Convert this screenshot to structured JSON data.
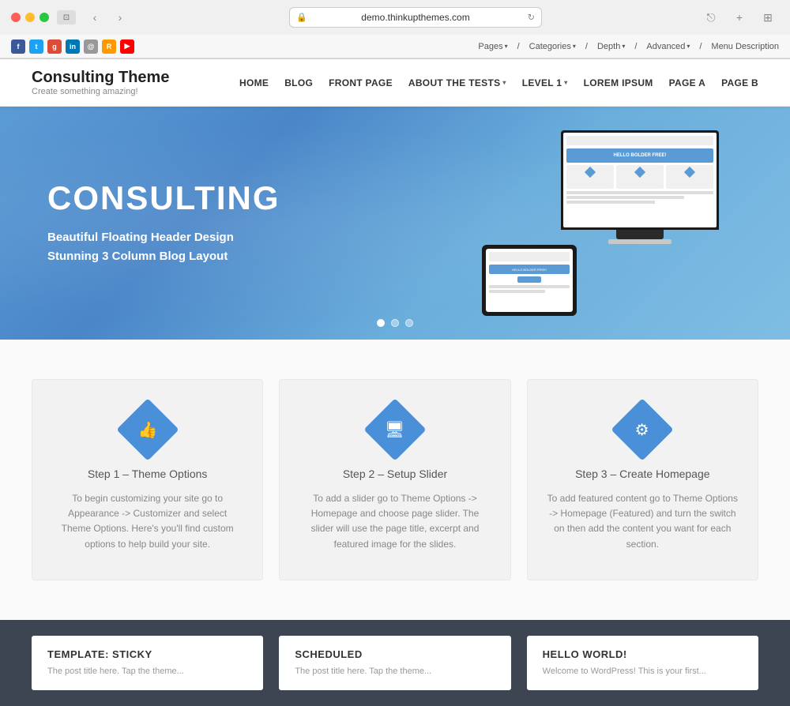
{
  "browser": {
    "url": "demo.thinkupthemes.com",
    "refresh_icon": "↻",
    "security_icon": "🔒",
    "back_icon": "‹",
    "forward_icon": "›",
    "share_icon": "⎋",
    "new_tab_icon": "+",
    "grid_icon": "⊞",
    "window_icon": "⊡"
  },
  "toolbar2": {
    "social": [
      {
        "name": "Facebook",
        "label": "f",
        "class": "si-fb"
      },
      {
        "name": "Twitter",
        "label": "t",
        "class": "si-tw"
      },
      {
        "name": "Google+",
        "label": "g+",
        "class": "si-gp"
      },
      {
        "name": "LinkedIn",
        "label": "in",
        "class": "si-li"
      },
      {
        "name": "Email",
        "label": "@",
        "class": "si-em"
      },
      {
        "name": "RSS",
        "label": "R",
        "class": "si-rss"
      },
      {
        "name": "YouTube",
        "label": "▶",
        "class": "si-yt"
      }
    ],
    "menu_items": [
      {
        "label": "Pages"
      },
      {
        "label": "Categories"
      },
      {
        "label": "Depth"
      },
      {
        "label": "Advanced"
      },
      {
        "label": "Menu Description",
        "no_arrow": true
      }
    ]
  },
  "site": {
    "logo": {
      "title": "Consulting Theme",
      "tagline": "Create something amazing!"
    },
    "nav": [
      {
        "label": "HOME",
        "has_dropdown": false
      },
      {
        "label": "BLOG",
        "has_dropdown": false
      },
      {
        "label": "FRONT PAGE",
        "has_dropdown": false
      },
      {
        "label": "ABOUT THE TESTS",
        "has_dropdown": true
      },
      {
        "label": "LEVEL 1",
        "has_dropdown": true
      },
      {
        "label": "LOREM IPSUM",
        "has_dropdown": false
      },
      {
        "label": "PAGE A",
        "has_dropdown": false
      },
      {
        "label": "PAGE B",
        "has_dropdown": false
      }
    ],
    "hero": {
      "title": "CONSULTING",
      "subtitle_line1": "Beautiful Floating Header Design",
      "subtitle_line2": "Stunning 3 Column Blog Layout",
      "dots": [
        {
          "active": true
        },
        {
          "active": false
        },
        {
          "active": false
        }
      ]
    },
    "steps": [
      {
        "icon": "👍",
        "title": "Step 1 – Theme Options",
        "description": "To begin customizing your site go to Appearance -> Customizer and select Theme Options. Here's you'll find custom options to help build your site."
      },
      {
        "icon": "🖥",
        "title": "Step 2 – Setup Slider",
        "description": "To add a slider go to Theme Options -> Homepage and choose page slider. The slider will use the page title, excerpt and featured image for the slides."
      },
      {
        "icon": "⚙",
        "title": "Step 3 – Create Homepage",
        "description": "To add featured content go to Theme Options -> Homepage (Featured) and turn the switch on then add the content you want for each section."
      }
    ],
    "footer_cards": [
      {
        "title": "TEMPLATE: STICKY",
        "text": "The post title here. Tap the theme..."
      },
      {
        "title": "SCHEDULED",
        "text": "The post title here. Tap the theme..."
      },
      {
        "title": "HELLO WORLD!",
        "text": "Welcome to WordPress! This is your first..."
      }
    ]
  }
}
